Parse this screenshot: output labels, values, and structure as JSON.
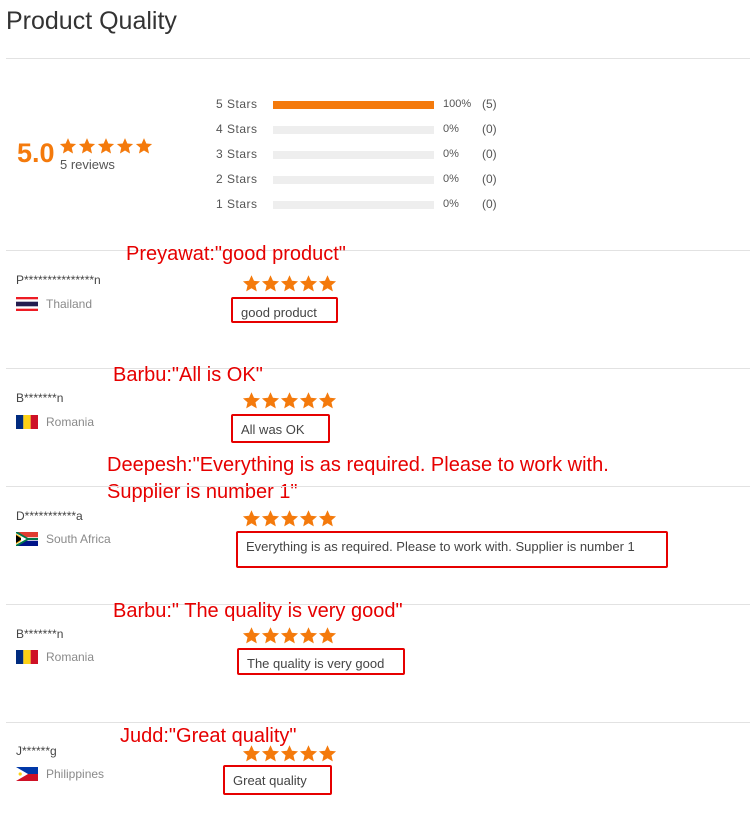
{
  "page": {
    "title": "Product Quality"
  },
  "summary": {
    "average": "5.0",
    "rating": 5,
    "review_count_label": "5 reviews",
    "accent_color": "#f47a0c"
  },
  "distribution": [
    {
      "label": "5 Stars",
      "percent_label": "100%",
      "count_label": "(5)",
      "fraction": 1.0
    },
    {
      "label": "4 Stars",
      "percent_label": "0%",
      "count_label": "(0)",
      "fraction": 0
    },
    {
      "label": "3 Stars",
      "percent_label": "0%",
      "count_label": "(0)",
      "fraction": 0
    },
    {
      "label": "2 Stars",
      "percent_label": "0%",
      "count_label": "(0)",
      "fraction": 0
    },
    {
      "label": "1 Stars",
      "percent_label": "0%",
      "count_label": "(0)",
      "fraction": 0
    }
  ],
  "annotation_color": "#e60000",
  "reviews": [
    {
      "user": "P***************n",
      "country": "Thailand",
      "flag": "flag-thailand",
      "rating": 5,
      "comment": "good product",
      "annotation": "Preyawat:\"good product\""
    },
    {
      "user": "B*******n",
      "country": "Romania",
      "flag": "flag-romania",
      "rating": 5,
      "comment": "All was OK",
      "annotation": "Barbu:\"All is OK\""
    },
    {
      "user": "D***********a",
      "country": "South Africa",
      "flag": "flag-south-africa",
      "rating": 5,
      "comment": "Everything is as required. Please to work with. Supplier is number 1",
      "annotation_line1": "Deepesh:\"Everything is as required. Please to work with.",
      "annotation_line2": "Supplier is number 1\""
    },
    {
      "user": "B*******n",
      "country": "Romania",
      "flag": "flag-romania",
      "rating": 5,
      "comment": "The quality is very good",
      "annotation": "Barbu:\" The quality is very good\""
    },
    {
      "user": "J******g",
      "country": "Philippines",
      "flag": "flag-philippines",
      "rating": 5,
      "comment": "Great quality",
      "annotation": "Judd:\"Great quality\""
    }
  ]
}
